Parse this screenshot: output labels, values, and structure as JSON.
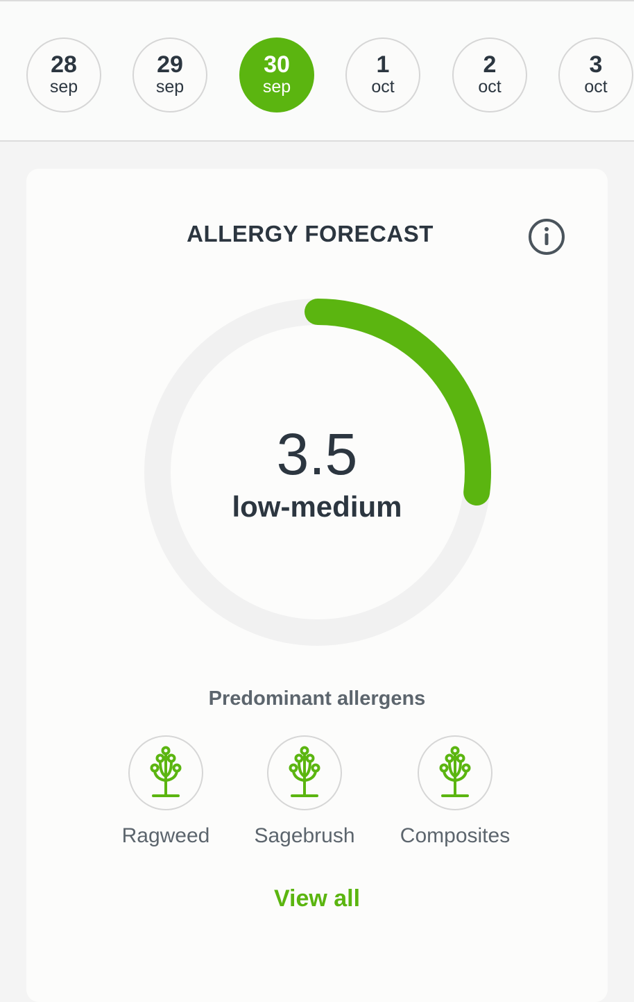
{
  "date_strip": {
    "dates": [
      {
        "day": "28",
        "month": "sep"
      },
      {
        "day": "29",
        "month": "sep"
      },
      {
        "day": "30",
        "month": "sep"
      },
      {
        "day": "1",
        "month": "oct"
      },
      {
        "day": "2",
        "month": "oct"
      },
      {
        "day": "3",
        "month": "oct"
      }
    ],
    "selected_index": 2
  },
  "forecast": {
    "title": "ALLERGY FORECAST",
    "info_icon": "info-icon",
    "value": "3.5",
    "level_label": "low-medium",
    "gauge_fraction": 0.27
  },
  "allergens": {
    "title": "Predominant allergens",
    "icon": "plant-icon",
    "items": [
      {
        "name": "Ragweed"
      },
      {
        "name": "Sagebrush"
      },
      {
        "name": "Composites"
      }
    ],
    "view_all_label": "View all"
  },
  "colors": {
    "accent": "#5bb510",
    "text": "#2c3640",
    "muted_text": "#5c656d",
    "gauge_track": "#f1f1f1"
  }
}
